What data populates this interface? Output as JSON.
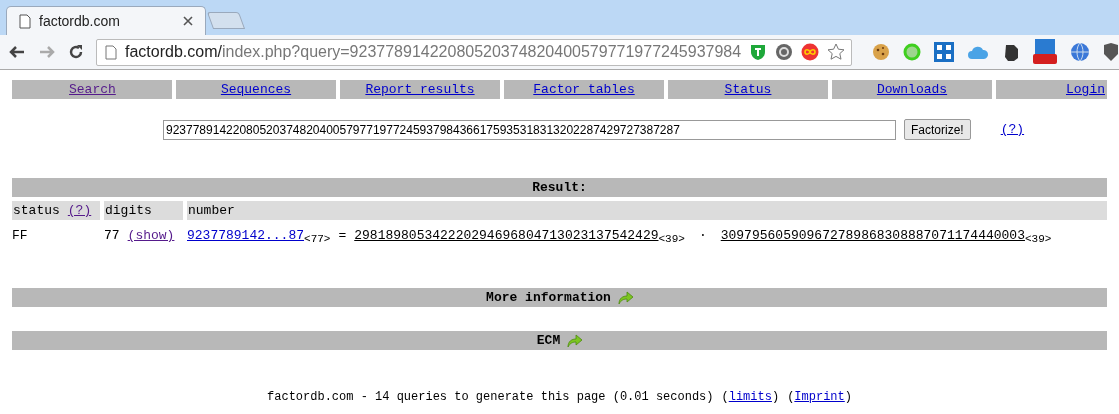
{
  "browser": {
    "tab_title": "factordb.com",
    "url_host": "factordb.com/",
    "url_path": "index.php?query=92377891422080520374820400579771977245937984"
  },
  "nav": [
    {
      "label": "Search",
      "visited": true
    },
    {
      "label": "Sequences",
      "visited": false
    },
    {
      "label": "Report results",
      "visited": false
    },
    {
      "label": "Factor tables",
      "visited": false
    },
    {
      "label": "Status",
      "visited": false
    },
    {
      "label": "Downloads",
      "visited": false
    },
    {
      "label": "Login",
      "visited": false
    }
  ],
  "query": {
    "value": "92377891422080520374820400579771977245937984366175935318313202287429727387287",
    "button": "Factorize!",
    "help": "(?)"
  },
  "result": {
    "title": "Result:",
    "columns": [
      {
        "label": "status",
        "help": "(?)"
      },
      {
        "label": "digits"
      },
      {
        "label": "number"
      }
    ],
    "row": {
      "status": "FF",
      "digits": "77",
      "show": "(show)",
      "number": "9237789142...87",
      "number_digits": "<77>",
      "equals": "=",
      "factors": [
        {
          "value": "298189805342220294696804713023137542429",
          "digits": "<39>"
        },
        {
          "value": "309795605909672789868308887071174440003",
          "digits": "<39>"
        }
      ],
      "separator": "·"
    }
  },
  "sections": [
    {
      "title": "More information"
    },
    {
      "title": "ECM"
    }
  ],
  "footer": {
    "text": "factordb.com - 14 queries to generate this page (0.01 seconds)",
    "links": [
      {
        "open": "(",
        "label": "limits",
        "close": ")"
      },
      {
        "open": "(",
        "label": "Imprint",
        "close": ")"
      }
    ]
  }
}
